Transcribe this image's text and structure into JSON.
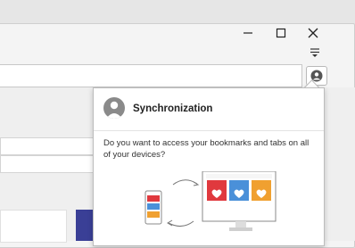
{
  "window": {
    "controls": {
      "minimize_icon": "minimize-icon",
      "maximize_icon": "maximize-icon",
      "close_icon": "close-icon"
    },
    "menu_icon": "hamburger-menu-icon"
  },
  "toolbar": {
    "profile_icon": "profile-icon"
  },
  "sync_popup": {
    "title": "Synchronization",
    "description": "Do you want to access your bookmarks and tabs on all of your devices?",
    "colors": {
      "red": "#e0393e",
      "blue": "#4a90d9",
      "orange": "#f0a030"
    }
  }
}
